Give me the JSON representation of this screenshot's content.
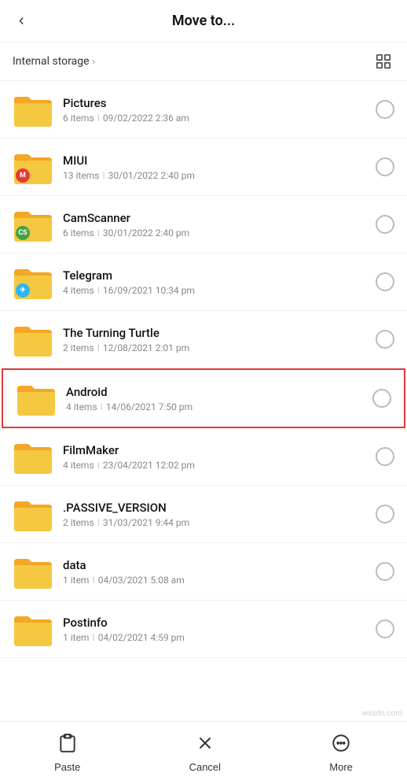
{
  "header": {
    "title": "Move to...",
    "back_label": "‹"
  },
  "breadcrumb": {
    "path": "Internal storage",
    "chevron": "›"
  },
  "folders": [
    {
      "name": "Pictures",
      "items": "6 items",
      "date": "09/02/2022 2:36 am",
      "badge": null,
      "highlighted": false
    },
    {
      "name": "MIUI",
      "items": "13 items",
      "date": "30/01/2022 2:40 pm",
      "badge": "red",
      "badge_text": "M",
      "highlighted": false
    },
    {
      "name": "CamScanner",
      "items": "6 items",
      "date": "30/01/2022 2:40 pm",
      "badge": "cs-green",
      "badge_text": "CS",
      "highlighted": false
    },
    {
      "name": "Telegram",
      "items": "4 items",
      "date": "16/09/2021 10:34 pm",
      "badge": "blue-tg",
      "badge_text": "✈",
      "highlighted": false
    },
    {
      "name": "The Turning Turtle",
      "items": "2 items",
      "date": "12/08/2021 2:01 pm",
      "badge": null,
      "highlighted": false
    },
    {
      "name": "Android",
      "items": "4 items",
      "date": "14/06/2021 7:50 pm",
      "badge": null,
      "highlighted": true
    },
    {
      "name": "FilmMaker",
      "items": "4 items",
      "date": "23/04/2021 12:02 pm",
      "badge": null,
      "highlighted": false
    },
    {
      "name": ".PASSIVE_VERSION",
      "items": "2 items",
      "date": "31/03/2021 9:44 pm",
      "badge": null,
      "highlighted": false
    },
    {
      "name": "data",
      "items": "1 item",
      "date": "04/03/2021 5:08 am",
      "badge": null,
      "highlighted": false
    },
    {
      "name": "Postinfo",
      "items": "1 item",
      "date": "04/02/2021 4:59 pm",
      "badge": null,
      "highlighted": false
    }
  ],
  "bottom_bar": {
    "paste_label": "Paste",
    "cancel_label": "Cancel",
    "more_label": "More"
  },
  "watermark": "wxsdn.com"
}
